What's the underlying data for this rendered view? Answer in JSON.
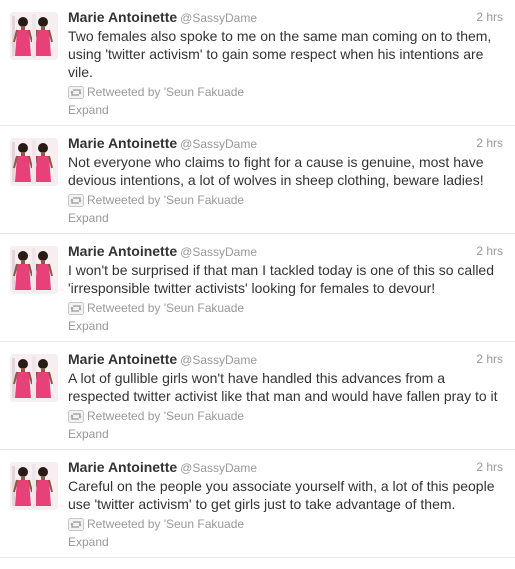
{
  "timeline": {
    "author_name": "Marie Antoinette",
    "author_handle": "@SassyDame",
    "avatar_icon": "profile-photo-icon",
    "retweet_icon": "retweet-icon",
    "colors": {
      "name": "#333333",
      "meta": "#999999",
      "divider": "#e8e8e8",
      "dress": "#e8417a"
    },
    "tweets": [
      {
        "time": "2 hrs",
        "text": "Two females also spoke to me on the same man coming on to them, using 'twitter activism' to gain some respect when his intentions are vile.",
        "retweeted_by": "Retweeted by 'Seun Fakuade",
        "expand": "Expand"
      },
      {
        "time": "2 hrs",
        "text": "Not everyone who claims to fight for a cause is genuine, most have devious intentions, a lot of wolves in sheep clothing, beware ladies!",
        "retweeted_by": "Retweeted by 'Seun Fakuade",
        "expand": "Expand"
      },
      {
        "time": "2 hrs",
        "text": "I won't be surprised if that man I tackled today is one of this so called 'irresponsible twitter activists' looking for females to devour!",
        "retweeted_by": "Retweeted by 'Seun Fakuade",
        "expand": "Expand"
      },
      {
        "time": "2 hrs",
        "text": "A lot of gullible girls won't have handled this advances from a respected twitter activist like that man and would have fallen pray to it",
        "retweeted_by": "Retweeted by 'Seun Fakuade",
        "expand": "Expand"
      },
      {
        "time": "2 hrs",
        "text": "Careful on the people you associate yourself with, a lot of this people use 'twitter activism' to get girls just to take advantage of them.",
        "retweeted_by": "Retweeted by 'Seun Fakuade",
        "expand": "Expand"
      }
    ]
  }
}
